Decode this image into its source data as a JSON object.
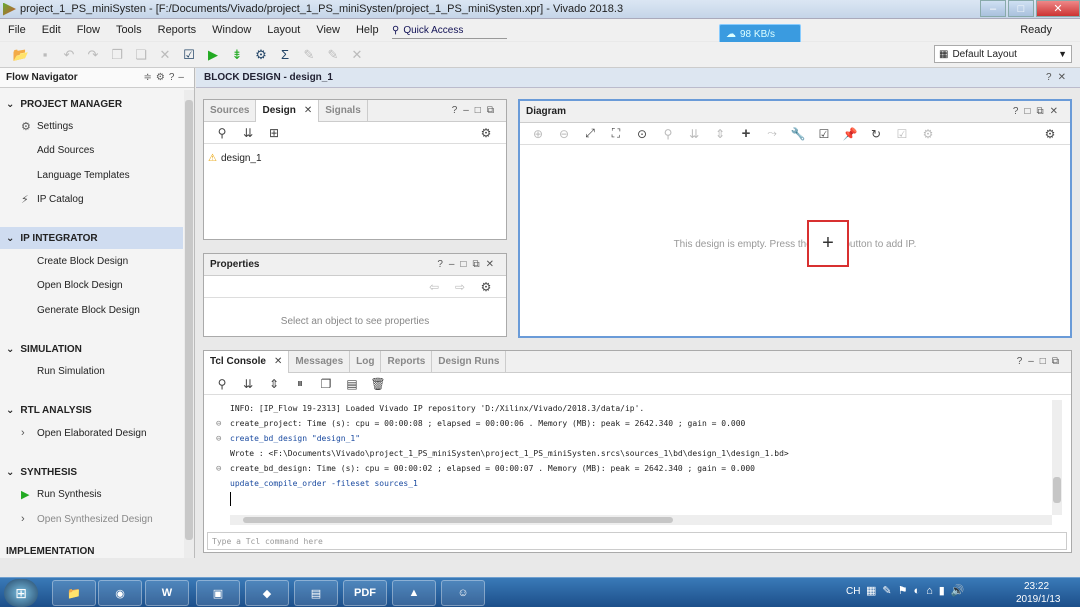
{
  "window": {
    "title": "project_1_PS_miniSysten - [F:/Documents/Vivado/project_1_PS_miniSysten/project_1_PS_miniSysten.xpr] - Vivado 2018.3"
  },
  "menu": [
    "File",
    "Edit",
    "Flow",
    "Tools",
    "Reports",
    "Window",
    "Layout",
    "View",
    "Help"
  ],
  "quick_access": "Quick Access",
  "net_speed": "98 KB/s",
  "status": "Ready",
  "layout_select": "Default Layout",
  "flow_navigator": {
    "title": "Flow Navigator",
    "sections": [
      {
        "label": "PROJECT MANAGER",
        "items": [
          "Settings",
          "Add Sources",
          "Language Templates",
          "IP Catalog"
        ]
      },
      {
        "label": "IP INTEGRATOR",
        "items": [
          "Create Block Design",
          "Open Block Design",
          "Generate Block Design"
        ]
      },
      {
        "label": "SIMULATION",
        "items": [
          "Run Simulation"
        ]
      },
      {
        "label": "RTL ANALYSIS",
        "items": [
          "Open Elaborated Design"
        ]
      },
      {
        "label": "SYNTHESIS",
        "items": [
          "Run Synthesis",
          "Open Synthesized Design"
        ]
      },
      {
        "label": "IMPLEMENTATION",
        "items": []
      }
    ]
  },
  "block_design": {
    "title": "BLOCK DESIGN - design_1"
  },
  "sources_panel": {
    "tabs": [
      "Sources",
      "Design",
      "Signals"
    ],
    "tree_item": "design_1"
  },
  "properties_panel": {
    "title": "Properties",
    "placeholder": "Select an object to see properties"
  },
  "diagram": {
    "title": "Diagram",
    "msg_before": "This design is empty. Press the",
    "msg_after": "button to add IP."
  },
  "console": {
    "tabs": [
      "Tcl Console",
      "Messages",
      "Log",
      "Reports",
      "Design Runs"
    ],
    "lines": [
      "INFO: [IP_Flow 19-2313] Loaded Vivado IP repository 'D:/Xilinx/Vivado/2018.3/data/ip'.",
      "create_project: Time (s): cpu = 00:00:08 ; elapsed = 00:00:06 . Memory (MB): peak = 2642.340 ; gain = 0.000",
      "create_bd_design \"design_1\"",
      "Wrote  : <F:\\Documents\\Vivado\\project_1_PS_miniSysten\\project_1_PS_miniSysten.srcs\\sources_1\\bd\\design_1\\design_1.bd>",
      "create_bd_design: Time (s): cpu = 00:00:02 ; elapsed = 00:00:07 . Memory (MB): peak = 2642.340 ; gain = 0.000",
      "update_compile_order -fileset sources_1"
    ],
    "input_placeholder": "Type a Tcl command here"
  },
  "taskbar": {
    "lang": "CH",
    "time": "23:22",
    "date": "2019/1/13"
  }
}
